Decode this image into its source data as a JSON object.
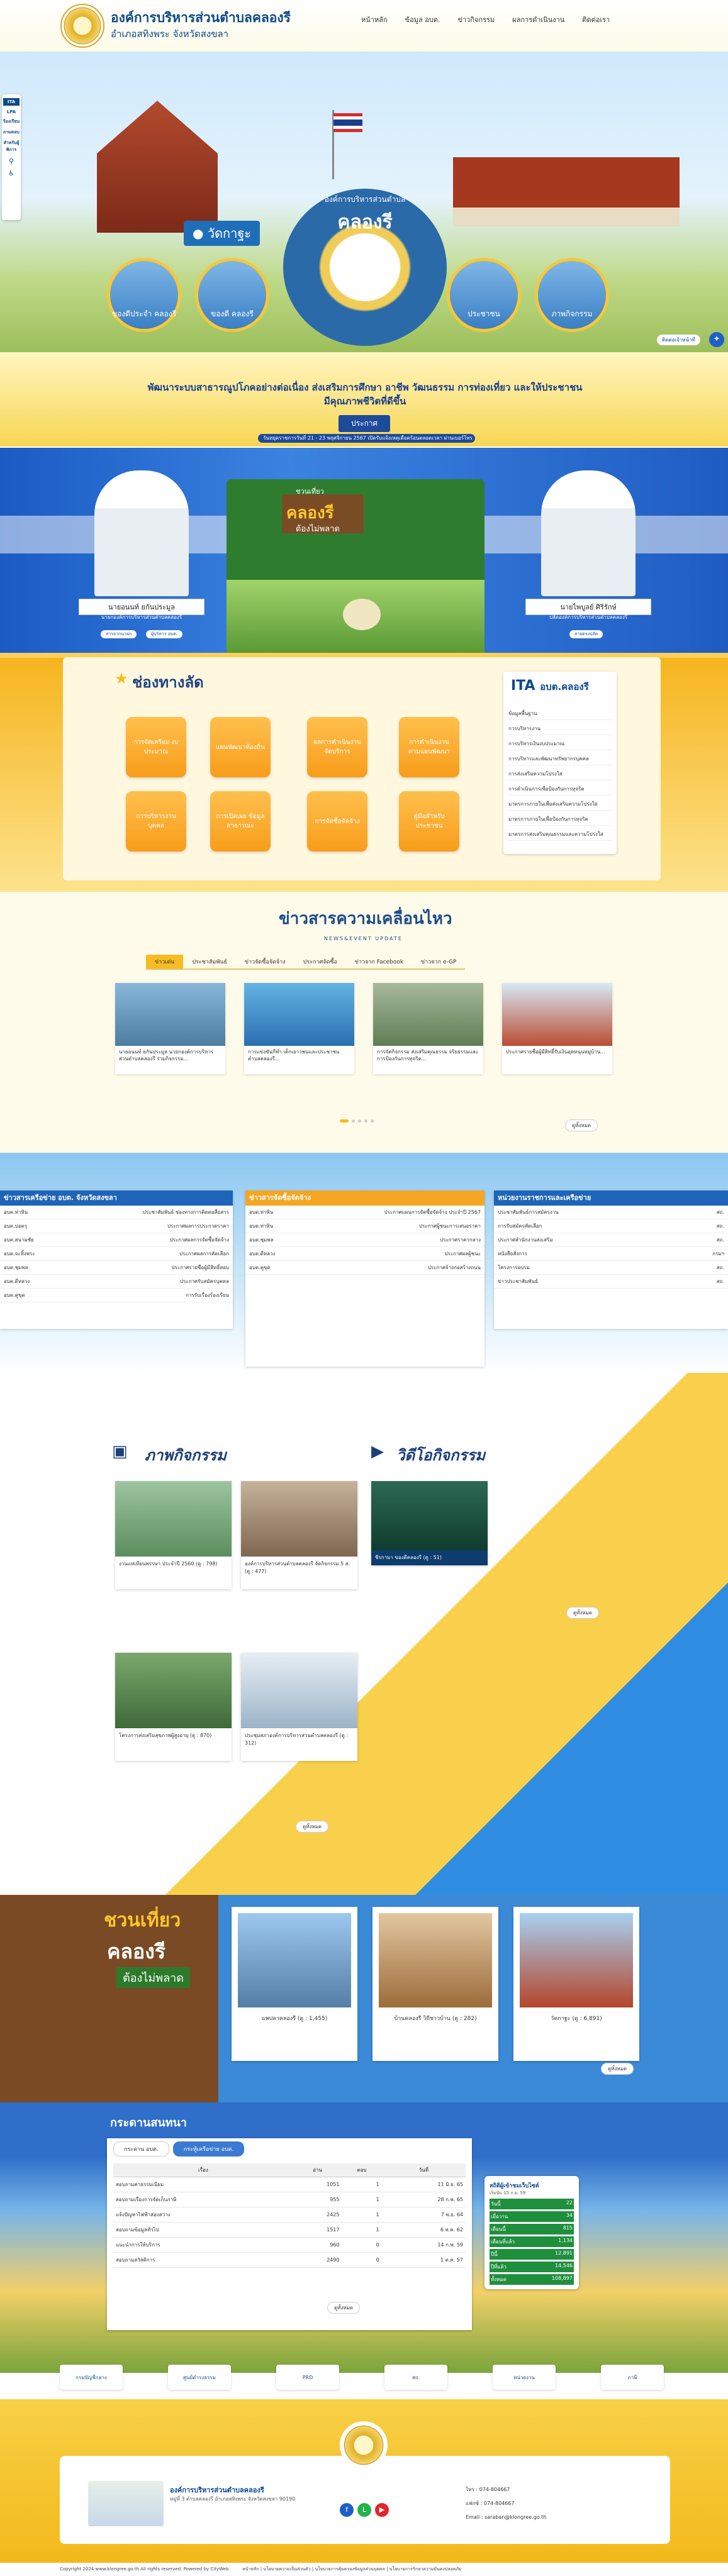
{
  "header": {
    "site_name": "องค์การบริหารส่วนตำบลคลองรี",
    "site_sub": "อำเภอสทิงพระ จังหวัดสงขลา",
    "nav": [
      "หน้าหลัก",
      "ข้อมูล อบต.",
      "ข่าวกิจกรรม",
      "ผลการดำเนินงาน",
      "ติดต่อเรา"
    ]
  },
  "sidebar": {
    "ita": "ITA",
    "lpa": "LPA",
    "items": [
      "ร้องเรียน",
      "ถามตอบ",
      "สำหรับผู้พิการ"
    ]
  },
  "hero": {
    "tag": "วัดกาฐะ",
    "center_title": "คลองรี",
    "center_arc": "องค์การบริหารส่วนตำบล",
    "circles": [
      "ของดีประจำ คลองรี",
      "ของดี คลองรี",
      "ประชาชน",
      "ภาพกิจกรรม"
    ],
    "chip": "ติดต่อเจ้าหน้าที่"
  },
  "mission": {
    "text": "พัฒนาระบบสาธารณูปโภคอย่างต่อเนื่อง ส่งเสริมการศึกษา อาชีพ วัฒนธรรม การท่องเที่ยว และให้ประชาชนมีคุณภาพชีวิตที่ดีขึ้น",
    "button": "ประกาศ",
    "ticker": "วันหยุดราชการวันที่ 21 - 23 พฤศจิกายน 2567 เปิดรับแจ้งเหตุเดือดร้อนตลอดเวลา ผ่านเบอร์โทร"
  },
  "executives": [
    {
      "name": "นายอนนท์ ยกันประมูล",
      "position": "นายกองค์การบริหารส่วนตำบลคลองรี",
      "btn1": "สารจากนายก",
      "btn2": "ผู้บริหาร อบต."
    },
    {
      "name": "นายไพบูลย์ ศิริรักษ์",
      "position": "ปลัดองค์การบริหารส่วนตำบลคลองรี",
      "btn1": "สายตรงปลัด"
    }
  ],
  "banner": {
    "title": "คลองรี",
    "sub": "ต้องไม่พลาด",
    "top": "ชวนเที่ยว"
  },
  "quicklinks": {
    "title": "ช่องทางลัด",
    "items": [
      "การจัดเตรียม งบประมาณ",
      "แผนพัฒนาท้องถิ่น",
      "ผลการดำเนินงาน จัดบริการ",
      "การดำเนินงาน ตามแผนพัฒนา",
      "การบริหารงาน บุคคล",
      "การเปิดเผย ข้อมูลสาธารณะ",
      "การจัดซื้อจัดจ้าง",
      "คู่มือสำหรับ ประชาชน"
    ]
  },
  "ita": {
    "title": "อบต.คลองรี",
    "items": [
      "ข้อมูลพื้นฐาน",
      "การบริหารงาน",
      "การบริหารเงินงบประมาณ",
      "การบริหารและพัฒนาทรัพยากรบุคคล",
      "การส่งเสริมความโปร่งใส",
      "การดำเนินการเพื่อป้องกันการทุจริต",
      "มาตรการภายในเพื่อส่งเสริมความโปร่งใส",
      "มาตรการภายในเพื่อป้องกันการทุจริต",
      "มาตรการส่งเสริมคุณธรรมและความโปร่งใส"
    ]
  },
  "news": {
    "title": "ข่าวสารความเคลื่อนไหว",
    "sub": "NEWS&EVENT UPDATE",
    "tabs": [
      "ข่าวเด่น",
      "ประชาสัมพันธ์",
      "ข่าวจัดซื้อจัดจ้าง",
      "ประกาศจัดซื้อ",
      "ข่าวจาก Facebook",
      "ข่าวจาก e-GP"
    ],
    "cards": [
      "นายอนนท์ ยกันประมูล นายกองค์การบริหารส่วนตำบลคลองรี ร่วมกิจกรรม...",
      "การแข่งขันกีฬา เด็กเยาวชนและประชาชน ตำบลคลองรี...",
      "การจัดกิจกรรม ส่งเสริมคุณธรรม จริยธรรมและการป้องกันการทุจริต...",
      "ประกาศรายชื่อผู้มีสิทธิ์รับเงินอุดหนุนหมู่บ้าน..."
    ],
    "more": "ดูทั้งหมด"
  },
  "columns": [
    {
      "title": "ข่าวสารเครือข่าย อบต. จังหวัดสงขลา",
      "rows": [
        [
          "อบต.ท่าหิน",
          "ประชาสัมพันธ์ ช่องทางการติดต่อสื่อสาร"
        ],
        [
          "อบต.บ่อตรุ",
          "ประกาศผลการประกวดราคา"
        ],
        [
          "อบต.สนามชัย",
          "ประกาศผลการจัดซื้อจัดจ้าง"
        ],
        [
          "อบต.จะทิ้งพระ",
          "ประกาศผลการคัดเลือก"
        ],
        [
          "อบต.ชุมพล",
          "ประกาศรายชื่อผู้มีสิทธิ์สอบ"
        ],
        [
          "อบต.ดีหลวง",
          "ประกาศรับสมัครบุคคล"
        ],
        [
          "อบต.คูขุด",
          "การรับเรื่องร้องเรียน"
        ]
      ]
    },
    {
      "title": "ข่าวสารจัดซื้อจัดจ้าง",
      "rows": [
        [
          "อบต.ท่าหิน",
          "ประกาศแผนการจัดซื้อจัดจ้าง ประจำปี 2567"
        ],
        [
          "อบต.ท่าหิน",
          "ประกาศผู้ชนะการเสนอราคา"
        ],
        [
          "อบต.ชุมพล",
          "ประกาศราคากลาง"
        ],
        [
          "อบต.ดีหลวง",
          "ประกาศผลผู้ชนะ"
        ],
        [
          "อบต.คูขุด",
          "ประกาศจ้างก่อสร้างถนน"
        ]
      ]
    },
    {
      "title": "หน่วยงานราชการและเครือข่าย",
      "rows": [
        [
          "ประชาสัมพันธ์การสมัครงาน",
          "สถ."
        ],
        [
          "การรับสมัครคัดเลือก",
          "สถ."
        ],
        [
          "ประกาศสำนักงานส่งเสริม",
          "สถ."
        ],
        [
          "หนังสือสั่งการ",
          "กรมฯ"
        ],
        [
          "โครงการอบรม",
          "สถ."
        ],
        [
          "ข่าวประชาสัมพันธ์",
          "สถ."
        ]
      ]
    }
  ],
  "activities": {
    "title": "ภาพกิจกรรม",
    "video_title": "วิดีโอกิจกรรม",
    "cards": [
      "งานแห่เทียนพรรษา ประจำปี 2560 (ดู : 798)",
      "องค์การบริหารส่วนตำบลคลองรี จัดกิจกรรม 5 ส. (ดู : 477)",
      "โครงการส่งเสริมสุขภาพผู้สูงอายุ (ดู : 870)",
      "ประชุมสภาองค์การบริหารส่วนตำบลคลองรี (ดู : 312)"
    ],
    "video_caption": "ชีรกามา ของดีคลองรี (ดู : 51)",
    "more": "ดูทั้งหมด"
  },
  "travel": {
    "t1": "ชวนเที่ยว",
    "t2": "คลองรี",
    "t3": "ต้องไม่พลาด",
    "cards": [
      "แพปลาคลองรี (ดู : 1,455)",
      "บ้านคลองรี วิถีชาวบ้าน (ดู : 282)",
      "วัดกาฐะ (ดู : 6,891)"
    ],
    "more": "ดูทั้งหมด"
  },
  "stats": {
    "title": "กระดานสนทนา",
    "tabs": [
      "กระดาน อบต.",
      "กระทู้เครือข่าย อบต."
    ],
    "headers": [
      "เรื่อง",
      "อ่าน",
      "ตอบ",
      "วันที่"
    ],
    "rows": [
      [
        "สอบถามค่าธรรมเนียม",
        "1051",
        "1",
        "11 มิ.ย. 65"
      ],
      [
        "สอบถามเรื่องการจัดเก็บภาษี",
        "955",
        "1",
        "28 ก.พ. 65"
      ],
      [
        "แจ้งปัญหาไฟฟ้าส่องสว่าง",
        "2425",
        "1",
        "7 พ.ย. 64"
      ],
      [
        "สอบถามข้อมูลทั่วไป",
        "1517",
        "1",
        "6 พ.ค. 62"
      ],
      [
        "แนะนำการให้บริการ",
        "960",
        "0",
        "14 ก.พ. 59"
      ],
      [
        "สอบถามสวัสดิการ",
        "2490",
        "0",
        "1 ต.ค. 57"
      ]
    ],
    "more": "ดูทั้งหมด",
    "visit_title": "สถิติผู้เข้าชมเว็บไซต์",
    "visit_sub": "เริ่มนับ 15 ก.ย. 59",
    "visits": [
      [
        "วันนี้",
        "22"
      ],
      [
        "เมื่อวาน",
        "34"
      ],
      [
        "เดือนนี้",
        "815"
      ],
      [
        "เดือนที่แล้ว",
        "1,134"
      ],
      [
        "ปีนี้",
        "12,891"
      ],
      [
        "ปีที่แล้ว",
        "14,546"
      ],
      [
        "ทั้งหมด",
        "108,897"
      ]
    ]
  },
  "partners": [
    "กรมบัญชีกลาง",
    "ศูนย์ดำรงธรรม",
    "PRD",
    "สถ.",
    "หน่วยงาน",
    "ภาษี"
  ],
  "footer": {
    "name": "องค์การบริหารส่วนตำบลคลองรี",
    "addr": "หมู่ที่ 3 ตำบลคลองรี อำเภอสทิงพระ จังหวัดสงขลา 90190",
    "tel": "โทร : 074-804667",
    "fax": "แฟกซ์ : 074-804667",
    "email": "Email : saraban@klongree.go.th",
    "bottom": "Copyright 2024 www.klongree.go.th All rights reserved. Powered by CityWeb",
    "links": "หน้าหลัก | นโยบายความเป็นส่วนตัว | นโยบายการคุ้มครองข้อมูลส่วนบุคคล | นโยบายการรักษาความมั่นคงปลอดภัย"
  },
  "colors": {
    "primary": "#0c4a86",
    "accent": "#f7bc22",
    "sky": "#3b83e0"
  }
}
